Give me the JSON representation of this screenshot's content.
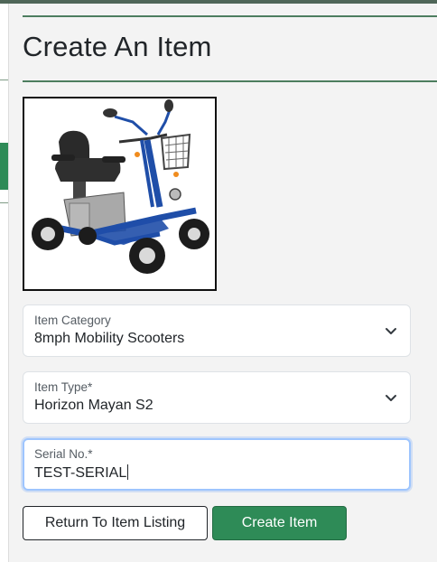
{
  "page": {
    "title": "Create An Item"
  },
  "product_image": {
    "alt": "8mph mobility scooter",
    "colors": {
      "frame": "#1f4ea8",
      "seat": "#2a2a2a",
      "body": "#a9a9a9"
    }
  },
  "form": {
    "category": {
      "label": "Item Category",
      "value": "8mph Mobility Scooters",
      "icon": "chevron-down-icon"
    },
    "type": {
      "label": "Item Type*",
      "value": "Horizon Mayan S2",
      "icon": "chevron-down-icon"
    },
    "serial": {
      "label": "Serial No.*",
      "value": "TEST-SERIAL"
    }
  },
  "actions": {
    "back_label": "Return To Item Listing",
    "create_label": "Create Item"
  },
  "colors": {
    "accent": "#2e8b57",
    "divider": "#4d7d5f",
    "focus": "#9ec5fe"
  }
}
